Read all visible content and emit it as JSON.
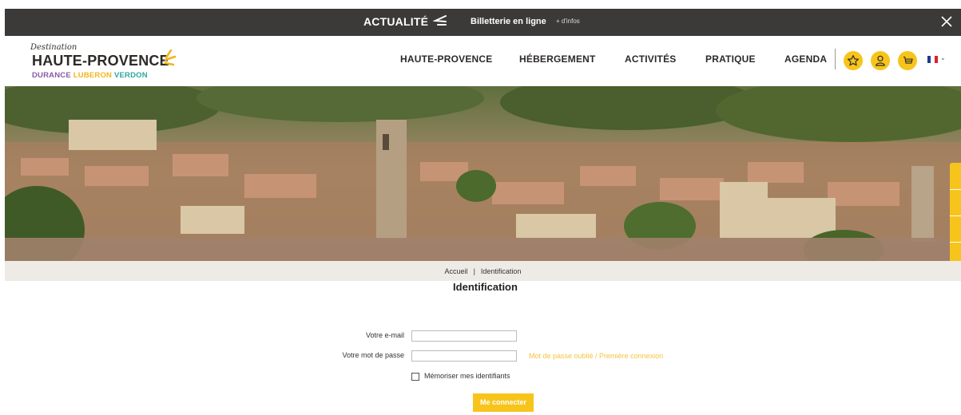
{
  "topbar": {
    "news_label": "ACTUALITÉ",
    "ticket_label": "Billetterie en ligne",
    "more_label": "+ d'infos"
  },
  "logo": {
    "script": "Destination",
    "main": "HAUTE-PROVENCE",
    "sub_1": "DURANCE",
    "sub_2": "LUBERON",
    "sub_3": "VERDON"
  },
  "nav": {
    "items": [
      "HAUTE-PROVENCE",
      "HÉBERGEMENT",
      "ACTIVITÉS",
      "PRATIQUE",
      "AGENDA"
    ]
  },
  "breadcrumb": {
    "home": "Accueil",
    "separator": "|",
    "current": "Identification"
  },
  "form": {
    "title": "Identification",
    "email_label": "Votre e-mail",
    "email_value": "",
    "password_label": "Votre mot de passe",
    "password_value": "",
    "forgot_link": "Mot de passe oublié / Première connexion",
    "remember_label": "Mémoriser mes identifiants",
    "remember_checked": false,
    "submit_label": "Me connecter"
  },
  "colors": {
    "accent_yellow": "#f7c41b",
    "topbar_bg": "#3b3a38",
    "logo_purple": "#8b5ba6",
    "logo_yellow": "#f3b51b",
    "logo_teal": "#2aa7a1",
    "breadcrumb_bg": "#eeebe7"
  },
  "icons": {
    "topbar": [
      "arrow-rays-icon",
      "close-icon"
    ],
    "header": [
      "star-icon",
      "user-icon",
      "cart-icon",
      "french-flag-icon",
      "chevron-down-icon"
    ],
    "side_tabs": [
      "home-icon",
      "document-icon",
      "bag-icon",
      "close-icon"
    ]
  }
}
